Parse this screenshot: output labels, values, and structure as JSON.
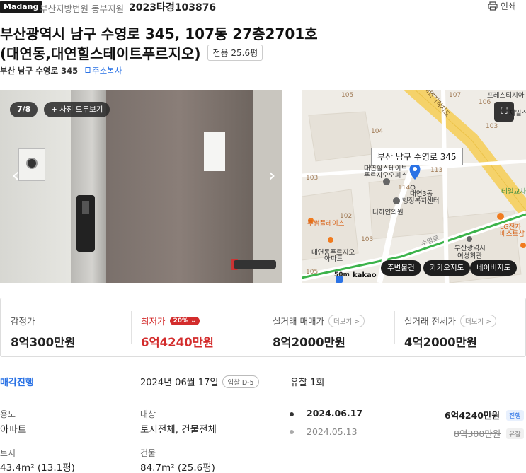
{
  "header": {
    "brand": "Madang",
    "court": "부산지방법원 동부지원",
    "case_no": "2023타경103876",
    "print_label": "인쇄"
  },
  "title": {
    "line1": "부산광역시 남구 수영로 345, 107동 27층2701호",
    "line2": "(대연동,대연힐스테이트푸르지오)",
    "area_badge": "전용 25.6평"
  },
  "address": {
    "short": "부산 남구 수영로 345",
    "copy_label": "주소복사"
  },
  "photo": {
    "counter": "7/8",
    "view_all": "+ 사진 모두보기"
  },
  "map": {
    "callout": "부산 남구 수영로 345",
    "buttons": [
      "주변물건",
      "카카오지도",
      "네이버지도"
    ],
    "scale": "50m",
    "provider": "kakao",
    "labels": [
      "대연힐스테이트",
      "푸르지오오피스",
      "대연3동",
      "행정복지센터",
      "더하얀의원",
      "투썸플레이스",
      "대연동푸르지오",
      "아파트",
      "LG전자",
      "베스트샵",
      "부산광역시",
      "여성회관",
      "테일교차",
      "제일스",
      "대연지하차도",
      "프레스티지아",
      "수영로"
    ],
    "numbers": [
      "105",
      "107",
      "106",
      "104",
      "103",
      "113",
      "114",
      "103",
      "102",
      "103",
      "105"
    ]
  },
  "prices": {
    "appraisal_label": "감정가",
    "appraisal_value": "8억300만원",
    "min_label": "최저가",
    "min_pct": "20%",
    "min_value": "6억4240만원",
    "sale_label": "실거래 매매가",
    "sale_more": "더보기 >",
    "sale_value": "8억2000만원",
    "jeonse_label": "실거래 전세가",
    "jeonse_more": "더보기 >",
    "jeonse_value": "4억2000만원"
  },
  "details": {
    "status": "매각진행",
    "auction_date": "2024년 06월 17일",
    "dday": "입찰 D-5",
    "fail_count": "유찰 1회",
    "usage_label": "용도",
    "usage_value": "아파트",
    "target_label": "대상",
    "target_value": "토지전체, 건물전체",
    "land_label": "토지",
    "land_value": "43.4m² (13.1평)",
    "building_label": "건물",
    "building_value": "84.7m² (25.6평)"
  },
  "history": [
    {
      "date": "2024.06.17",
      "price": "6억4240만원",
      "badge": "진행"
    },
    {
      "date": "2024.05.13",
      "price": "8억300만원",
      "badge": "유찰"
    }
  ]
}
